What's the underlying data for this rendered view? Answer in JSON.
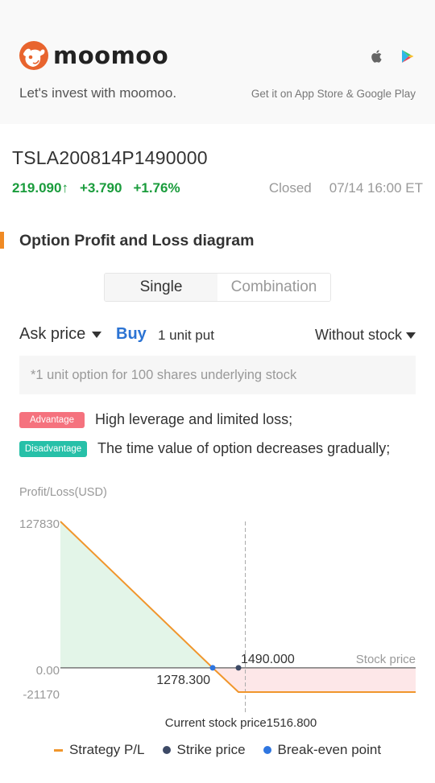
{
  "banner": {
    "brand": "moomoo",
    "tagline": "Let's invest with moomoo.",
    "store_text": "Get it on App Store & Google Play",
    "icons": [
      "apple-icon",
      "google-play-icon"
    ],
    "brand_color": "#e8642e"
  },
  "quote": {
    "ticker": "TSLA200814P1490000",
    "price": "219.090",
    "price_arrow": "↑",
    "change": "+3.790",
    "change_pct": "+1.76%",
    "status": "Closed",
    "timestamp": "07/14 16:00 ET",
    "up_color": "#1a9c3c"
  },
  "section": {
    "title": "Option Profit and Loss diagram",
    "accent_color": "#f08a24"
  },
  "segmented": {
    "options": [
      {
        "label": "Single",
        "active": true
      },
      {
        "label": "Combination",
        "active": false
      }
    ]
  },
  "controls": {
    "price_type": "Ask price",
    "side": "Buy",
    "position": "1 unit put",
    "stock_mode": "Without stock"
  },
  "note": "*1 unit option for 100 shares underlying stock",
  "pros_cons": [
    {
      "badge": "Advantage",
      "text": "High leverage and limited loss;",
      "color": "#f5727e"
    },
    {
      "badge": "Disadvantage",
      "text": "The time value of option decreases gradually;",
      "color": "#27c0a8"
    }
  ],
  "chart_data": {
    "type": "line",
    "title": "",
    "ylabel": "Profit/Loss(USD)",
    "xlabel": "Stock price",
    "y_ticks": [
      "127830",
      "0.00",
      "-21170"
    ],
    "ylim": [
      -21170,
      127830
    ],
    "max_profit": 127830,
    "max_loss": -21170,
    "break_even": 1278.3,
    "break_even_label": "1278.300",
    "strike": 1490.0,
    "strike_label": "1490.000",
    "current_price": 1516.8,
    "current_price_label": "Current stock price1516.800",
    "series": [
      {
        "name": "Strategy P/L",
        "points": [
          [
            0,
            127830
          ],
          [
            1278.3,
            0
          ],
          [
            1490.0,
            -21170
          ],
          [
            2050,
            -21170
          ]
        ]
      }
    ],
    "xlim": [
      0,
      2050
    ],
    "legend": [
      {
        "label": "Strategy P/L",
        "kind": "line",
        "color": "#f0962c"
      },
      {
        "label": "Strike price",
        "kind": "dot",
        "color": "#3d4a66"
      },
      {
        "label": "Break-even point",
        "kind": "dot",
        "color": "#2f76e0"
      }
    ],
    "legend_position": "bottom",
    "profit_fill": "#e3f5e8",
    "loss_fill": "#fde7e8"
  }
}
